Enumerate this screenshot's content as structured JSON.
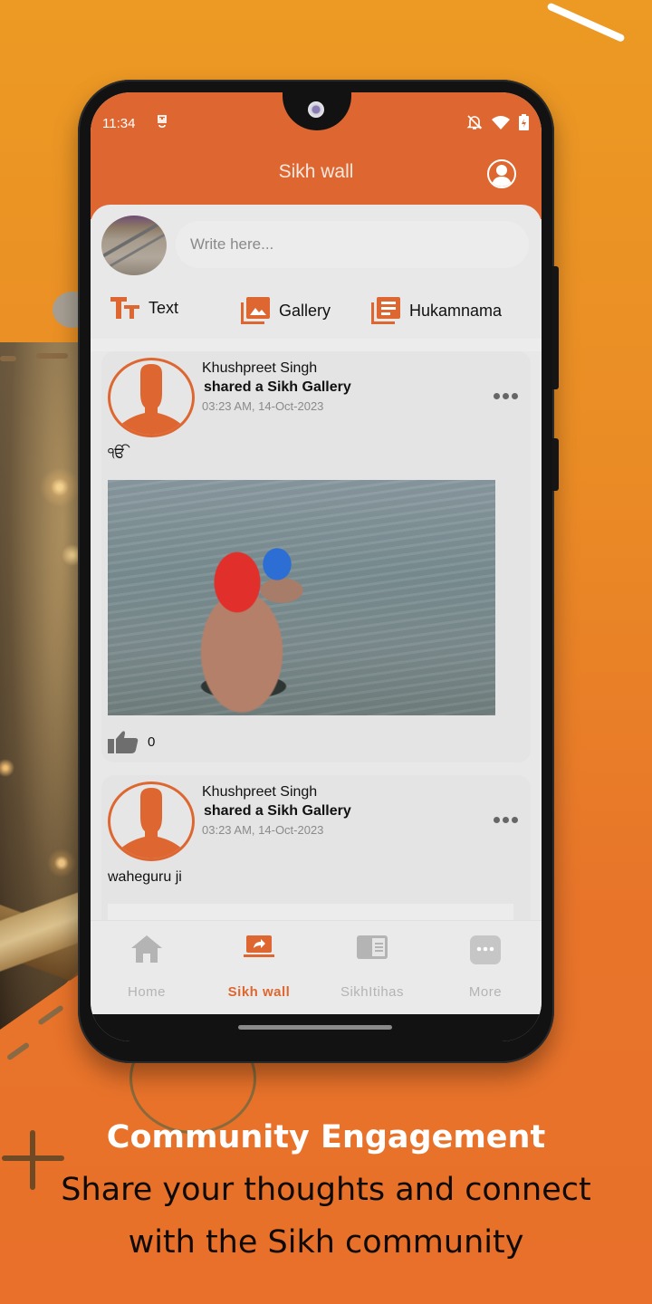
{
  "status_bar": {
    "time": "11:34",
    "icons": [
      "app-notification-icon",
      "bell-off-icon",
      "wifi-icon",
      "battery-charging-icon"
    ]
  },
  "app_bar": {
    "title": "Sikh wall",
    "profile_icon": "user-profile-icon"
  },
  "composer": {
    "placeholder": "Write here...",
    "value": "",
    "post_types": [
      {
        "label": "Text",
        "icon": "text-format-icon"
      },
      {
        "label": "Gallery",
        "icon": "gallery-icon"
      },
      {
        "label": "Hukamnama",
        "icon": "document-list-icon"
      }
    ]
  },
  "feed": {
    "posts": [
      {
        "author": "Khushpreet Singh",
        "action_prefix": "shared a",
        "action_target": "Sikh Gallery",
        "timestamp": "03:23 AM, 14-Oct-2023",
        "text": "ੴ",
        "has_image": true,
        "image_description": "Two Sikh men in red and blue turbans bathing in water",
        "likes": "0"
      },
      {
        "author": "Khushpreet Singh",
        "action_prefix": "shared a",
        "action_target": "Sikh Gallery",
        "timestamp": "03:23 AM, 14-Oct-2023",
        "text": "waheguru ji",
        "has_image": true
      }
    ]
  },
  "bottom_nav": {
    "items": [
      {
        "label": "Home",
        "icon": "home-icon",
        "active": false
      },
      {
        "label": "Sikh wall",
        "icon": "share-screen-icon",
        "active": true
      },
      {
        "label": "SikhItihas",
        "icon": "book-icon",
        "active": false
      },
      {
        "label": "More",
        "icon": "more-icon",
        "active": false
      }
    ]
  },
  "promo": {
    "title": "Community Engagement",
    "line1": "Share your thoughts and connect",
    "line2": "with the Sikh community"
  },
  "colors": {
    "accent": "#de6731",
    "background_top": "#ec9a24",
    "background_bottom": "#e8702a",
    "inactive_nav": "#b4b4b4"
  }
}
